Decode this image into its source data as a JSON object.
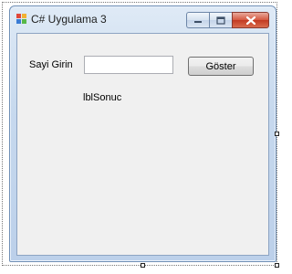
{
  "window": {
    "title": "C# Uygulama 3"
  },
  "form": {
    "input_label": "Sayi Girin",
    "input_value": "",
    "button_label": "Göster",
    "result_label": "lblSonuc"
  },
  "icons": {
    "app": "app-form-icon",
    "minimize": "minimize-icon",
    "maximize": "maximize-icon",
    "close": "close-icon"
  },
  "colors": {
    "close_button": "#c94a32",
    "client_background": "#f0f0f0",
    "titlebar_accent": "#c7d9ee"
  }
}
